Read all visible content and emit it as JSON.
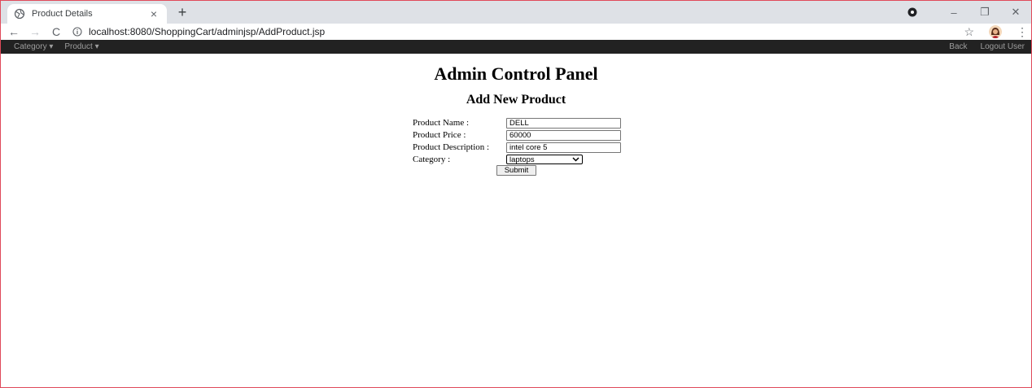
{
  "browser": {
    "tab": {
      "title": "Product Details",
      "favicon": "globe-icon",
      "close": "×"
    },
    "new_tab": "+",
    "window_controls": {
      "minimize": "–",
      "restore": "❐",
      "close": "✕"
    },
    "url": "localhost:8080/ShoppingCart/adminjsp/AddProduct.jsp",
    "nav": {
      "back": "←",
      "forward": "→",
      "reload": "C"
    },
    "star": "☆",
    "menu": "⋮"
  },
  "navbar": {
    "left": [
      {
        "label": "Category ▾"
      },
      {
        "label": "Product ▾"
      }
    ],
    "right": [
      {
        "label": "Back"
      },
      {
        "label": "Logout User"
      }
    ]
  },
  "page": {
    "heading": "Admin Control Panel",
    "subheading": "Add New Product"
  },
  "form": {
    "product_name": {
      "label": "Product Name :",
      "value": "DELL"
    },
    "product_price": {
      "label": "Product Price :",
      "value": "60000"
    },
    "product_description": {
      "label": "Product Description :",
      "value": "intel core 5"
    },
    "category": {
      "label": "Category :",
      "selected": "laptops"
    },
    "submit_label": "Submit"
  },
  "colors": {
    "tabstrip": "#dee1e6",
    "navbar": "#222222",
    "navbar_text": "#9d9d9d",
    "window_border": "#e04a5a"
  }
}
